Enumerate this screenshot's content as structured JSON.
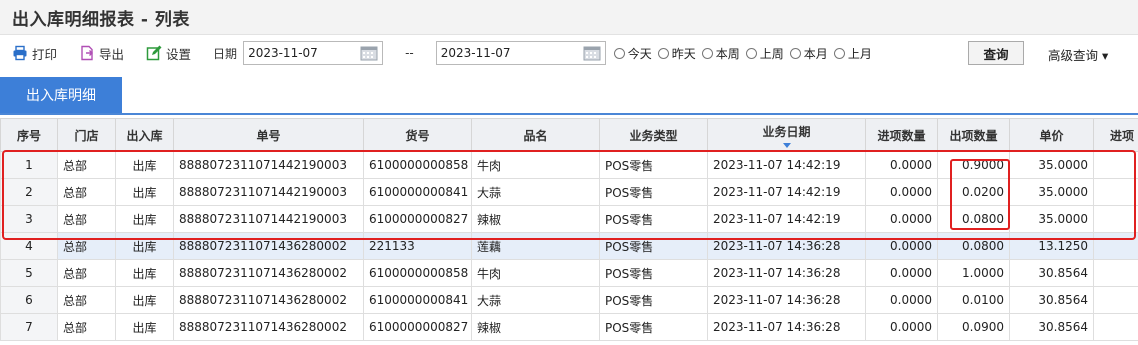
{
  "page": {
    "title": "出入库明细报表 - 列表"
  },
  "toolbar": {
    "print": "打印",
    "export": "导出",
    "settings": "设置",
    "date_label": "日期",
    "date_from": "2023-11-07",
    "date_sep": "--",
    "date_to": "2023-11-07",
    "radios": [
      "今天",
      "昨天",
      "本周",
      "上周",
      "本月",
      "上月"
    ],
    "query": "查询",
    "advanced": "高级查询 ▾"
  },
  "tab": {
    "active": "出入库明细"
  },
  "table": {
    "headers": [
      "序号",
      "门店",
      "出入库",
      "单号",
      "货号",
      "品名",
      "业务类型",
      "业务日期",
      "进项数量",
      "出项数量",
      "单价",
      "进项"
    ],
    "rows": [
      [
        "1",
        "总部",
        "出库",
        "8888072311071442190003",
        "6100000000858",
        "牛肉",
        "POS零售",
        "2023-11-07 14:42:19",
        "0.0000",
        "0.9000",
        "35.0000",
        ""
      ],
      [
        "2",
        "总部",
        "出库",
        "8888072311071442190003",
        "6100000000841",
        "大蒜",
        "POS零售",
        "2023-11-07 14:42:19",
        "0.0000",
        "0.0200",
        "35.0000",
        ""
      ],
      [
        "3",
        "总部",
        "出库",
        "8888072311071442190003",
        "6100000000827",
        "辣椒",
        "POS零售",
        "2023-11-07 14:42:19",
        "0.0000",
        "0.0800",
        "35.0000",
        ""
      ],
      [
        "4",
        "总部",
        "出库",
        "8888072311071436280002",
        "221133",
        "莲藕",
        "POS零售",
        "2023-11-07 14:36:28",
        "0.0000",
        "0.0800",
        "13.1250",
        ""
      ],
      [
        "5",
        "总部",
        "出库",
        "8888072311071436280002",
        "6100000000858",
        "牛肉",
        "POS零售",
        "2023-11-07 14:36:28",
        "0.0000",
        "1.0000",
        "30.8564",
        ""
      ],
      [
        "6",
        "总部",
        "出库",
        "8888072311071436280002",
        "6100000000841",
        "大蒜",
        "POS零售",
        "2023-11-07 14:36:28",
        "0.0000",
        "0.0100",
        "30.8564",
        ""
      ],
      [
        "7",
        "总部",
        "出库",
        "8888072311071436280002",
        "6100000000827",
        "辣椒",
        "POS零售",
        "2023-11-07 14:36:28",
        "0.0000",
        "0.0900",
        "30.8564",
        ""
      ]
    ]
  },
  "colors": {
    "accent": "#3d7fd8",
    "highlight_box": "#e02020",
    "row_highlight": "#e6eef9"
  }
}
